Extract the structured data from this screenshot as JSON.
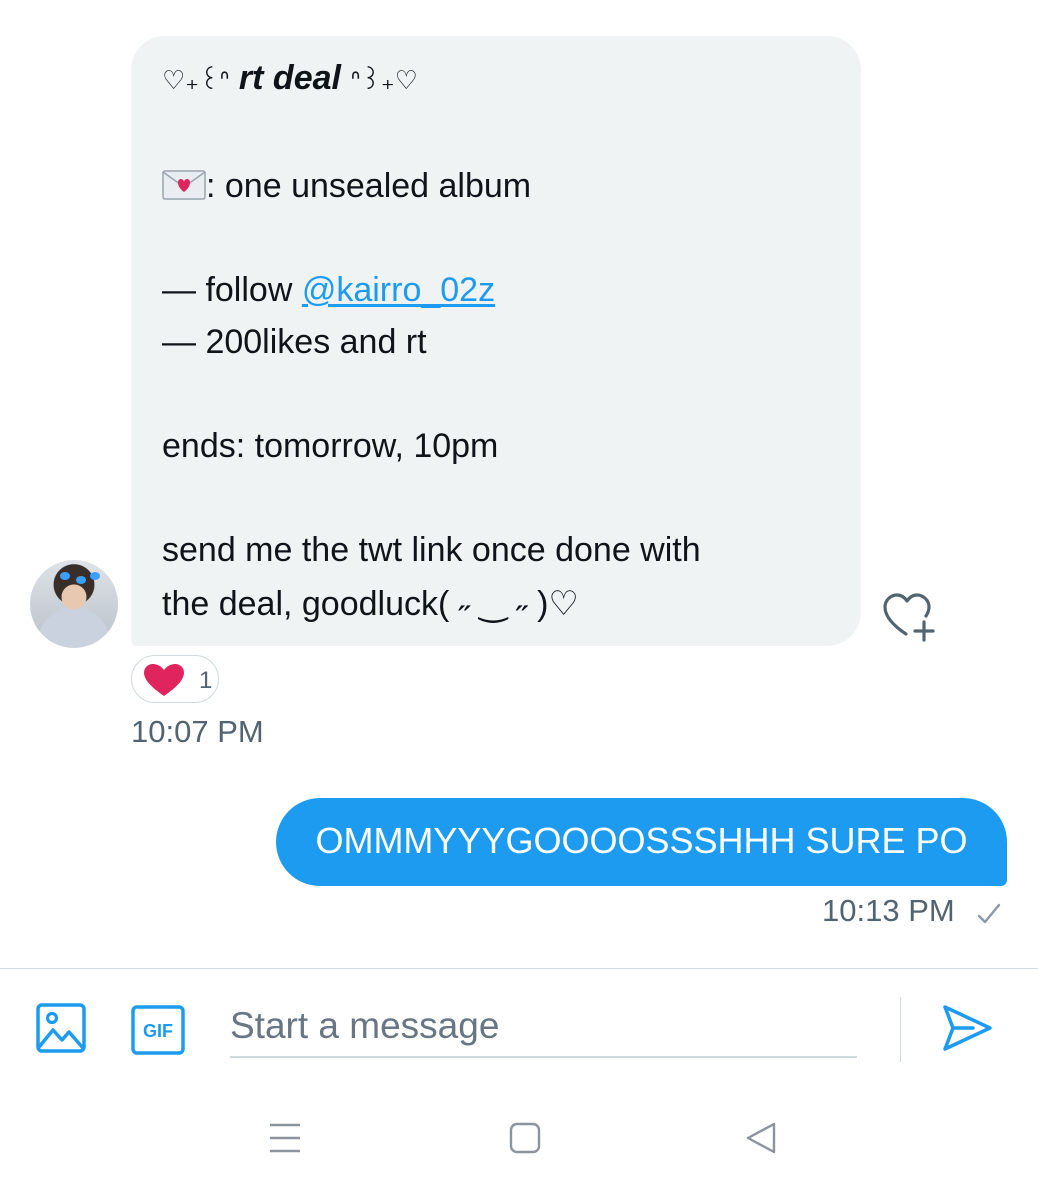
{
  "incoming_message": {
    "title": {
      "prefix": "♡₊꒰ᐢ",
      "text": "rt deal",
      "suffix": "ᐢ꒱₊♡"
    },
    "prize_icon": "love-letter-icon",
    "prize_text": ": one unsealed album",
    "follow_prefix": "— follow ",
    "mention": "@kairro_02z",
    "requirement": "— 200likes and rt",
    "ends": "ends: tomorrow, 10pm",
    "closing_line1": "send me the twt link once done with",
    "closing_line2": "the deal, goodluck( ˶ ‿ ˶ )♡",
    "reaction_count": "1",
    "timestamp": "10:07 PM"
  },
  "outgoing_message": {
    "text": "OMMMYYYGOOOOSSSHHH SURE PO",
    "timestamp": "10:13 PM",
    "status_icon": "sent-check-icon"
  },
  "composer": {
    "placeholder": "Start a message",
    "gif_label": "GIF"
  },
  "colors": {
    "accent": "#1d9bf0",
    "incoming_bubble": "#eff3f4",
    "reaction_heart": "#f91880",
    "secondary_text": "#536471"
  }
}
